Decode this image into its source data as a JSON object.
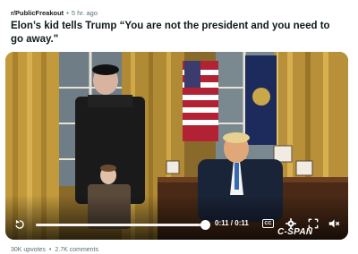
{
  "post": {
    "subreddit": "r/PublicFreakout",
    "separator": "•",
    "age": "5 hr. ago",
    "title": "Elon’s kid tells Trump “You are not the president and you need to go away.\""
  },
  "video": {
    "time_display": "0:11 / 0:11",
    "progress_fraction": 1.0,
    "cc_label": "CC",
    "watermark": "C-SPAN",
    "icons": {
      "replay": "replay-icon",
      "settings": "gear-icon",
      "fullscreen": "fullscreen-icon",
      "mute": "mute-icon",
      "captions": "captions-icon"
    }
  },
  "stats": {
    "upvotes": "30K upvotes",
    "separator": "•",
    "comments": "2.7K comments"
  }
}
